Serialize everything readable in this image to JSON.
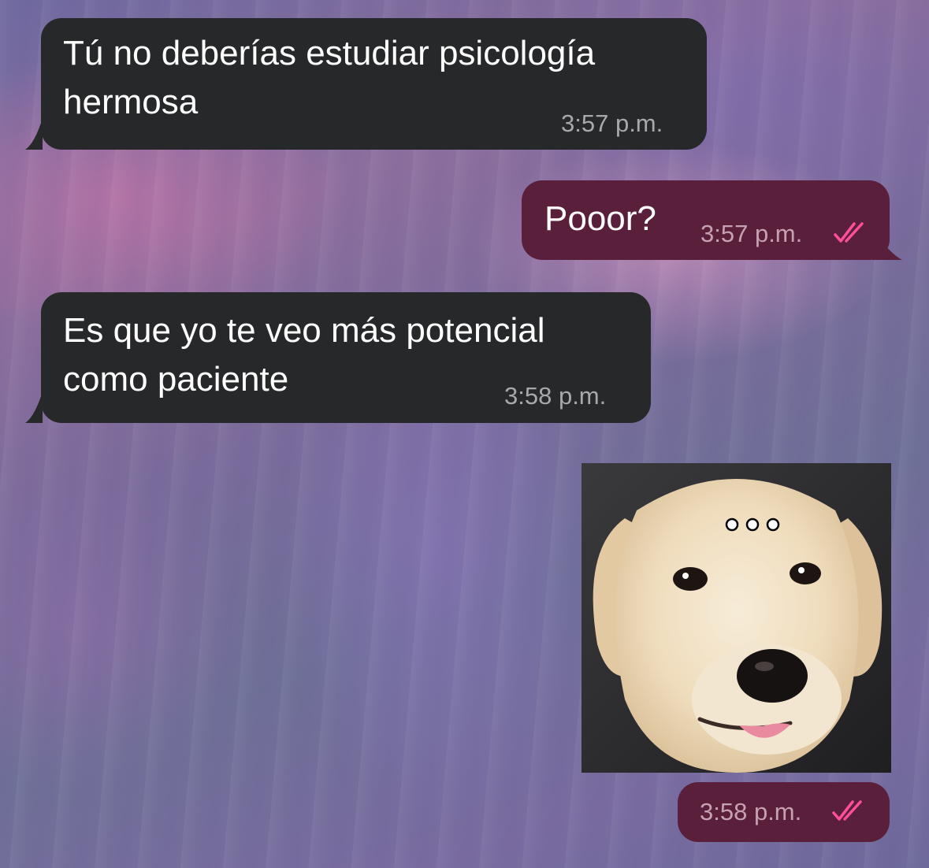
{
  "messages": [
    {
      "direction": "incoming",
      "text": "Tú no deberías estudiar psicología\nhermosa",
      "time": "3:57 p.m."
    },
    {
      "direction": "outgoing",
      "text": "Pooor?",
      "time": "3:57 p.m.",
      "status": "read"
    },
    {
      "direction": "incoming",
      "text": "Es que yo te veo más potencial\ncomo paciente",
      "time": "3:58 p.m."
    },
    {
      "direction": "outgoing",
      "type": "sticker",
      "sticker": "dog-face-sticker",
      "time": "3:58 p.m.",
      "status": "read"
    }
  ],
  "colors": {
    "incoming_bubble": "#262829",
    "outgoing_bubble": "#5a1f3a",
    "read_checks": "#ff4f9a"
  }
}
